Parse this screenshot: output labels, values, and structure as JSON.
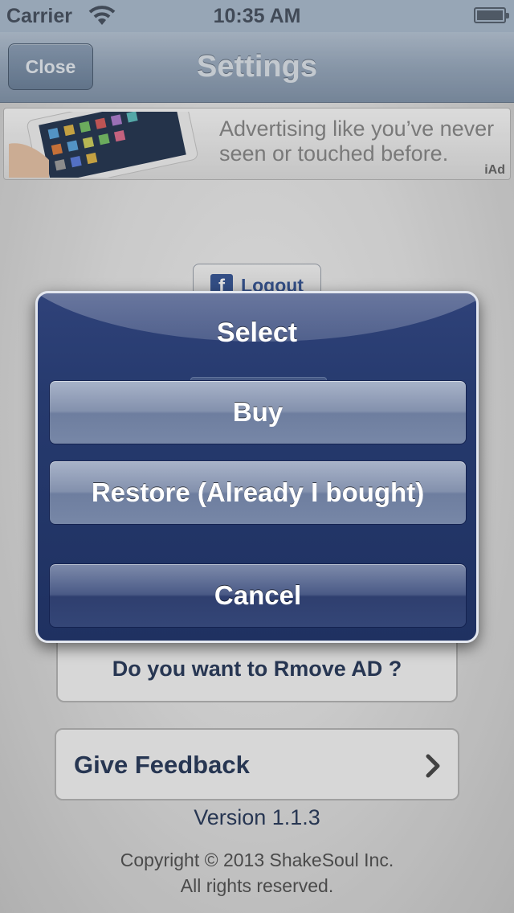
{
  "status_bar": {
    "carrier": "Carrier",
    "time": "10:35 AM"
  },
  "nav": {
    "close_label": "Close",
    "title": "Settings"
  },
  "ad": {
    "text": "Advertising like you’ve never seen or touched before.",
    "badge": "iAd"
  },
  "background": {
    "facebook_logout": "Logout",
    "remove_ad": "Do you want to Rmove AD ?",
    "feedback": "Give Feedback",
    "version": "Version 1.1.3",
    "copyright_line1": "Copyright © 2013 ShakeSoul Inc.",
    "copyright_line2": "All rights reserved."
  },
  "alert": {
    "title": "Select",
    "buttons": [
      {
        "label": "Buy"
      },
      {
        "label": "Restore (Already I bought)"
      },
      {
        "label": "Cancel"
      }
    ]
  },
  "colors": {
    "alert_bg": "#263a6e",
    "link_text": "#2d3e5e",
    "facebook": "#3b5998"
  },
  "icons": [
    "wifi-icon",
    "battery-icon",
    "facebook-icon",
    "chevron-right-icon",
    "tablet-image"
  ]
}
